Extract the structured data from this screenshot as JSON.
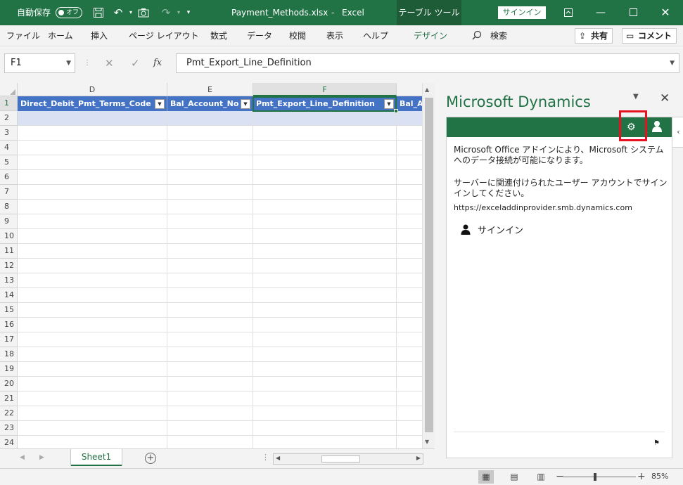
{
  "titlebar": {
    "autosave_label": "自動保存",
    "autosave_state": "オフ",
    "filename": "Payment_Methods.xlsx",
    "separator": "-",
    "app_name": "Excel",
    "context_tab": "テーブル ツール",
    "signin_label": "サインイン",
    "window_controls": [
      "ribbon-display-icon",
      "minimize-icon",
      "maximize-icon",
      "close-icon"
    ]
  },
  "ribbon": {
    "tabs": [
      "ファイル",
      "ホーム",
      "挿入",
      "ページ レイアウト",
      "数式",
      "データ",
      "校閲",
      "表示",
      "ヘルプ",
      "デザイン"
    ],
    "search_label": "検索",
    "share_label": "共有",
    "comment_label": "コメント"
  },
  "formula_bar": {
    "name_box": "F1",
    "fx_label": "fx",
    "formula": "Pmt_Export_Line_Definition"
  },
  "grid": {
    "columns": [
      "D",
      "E",
      "F"
    ],
    "selected_column": "F",
    "rows": [
      "1",
      "2",
      "3",
      "4",
      "5",
      "6",
      "7",
      "8",
      "9",
      "10",
      "11",
      "12",
      "13",
      "14",
      "15",
      "16",
      "17",
      "18",
      "19",
      "20",
      "21",
      "22",
      "23",
      "24"
    ],
    "header_cells": [
      "Direct_Debit_Pmt_Terms_Code",
      "Bal_Account_No",
      "Pmt_Export_Line_Definition",
      "Bal_A"
    ]
  },
  "sheets": {
    "tabs": [
      "Sheet1"
    ],
    "active": "Sheet1"
  },
  "task_pane": {
    "title": "Microsoft Dynamics",
    "description": "Microsoft Office アドインにより、Microsoft システムへのデータ接続が可能になります。",
    "signin_instruction": "サーバーに関連付けられたユーザー アカウントでサインインしてください。",
    "server_url": "https://exceladdinprovider.smb.dynamics.com",
    "signin_link": "サインイン",
    "highlight_color": "#e81123"
  },
  "status_bar": {
    "zoom": "85%"
  },
  "colors": {
    "excel_green": "#217346",
    "table_header": "#4472c4",
    "table_band": "#d9e1f2"
  }
}
